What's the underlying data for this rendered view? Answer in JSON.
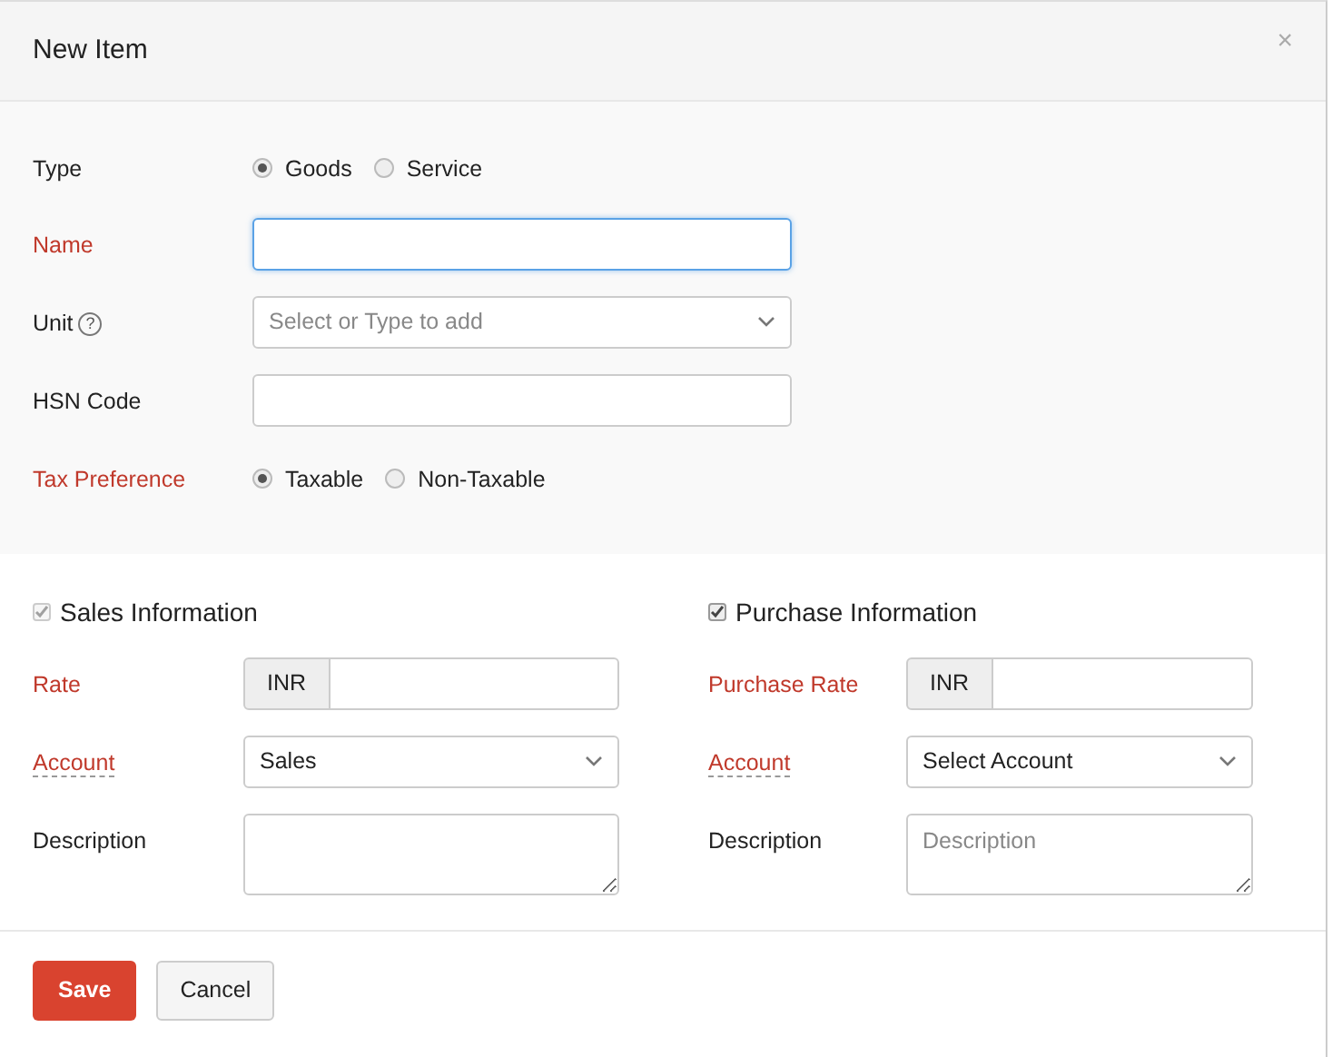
{
  "dialog": {
    "title": "New Item",
    "close": "×"
  },
  "fields": [
    {
      "label": "Type",
      "kind": "radio",
      "required": false,
      "options": [
        {
          "label": "Goods",
          "selected": true
        },
        {
          "label": "Service",
          "selected": false
        }
      ]
    },
    {
      "label": "Name",
      "kind": "text",
      "required": true,
      "focused": true
    },
    {
      "label": "Unit",
      "kind": "select",
      "required": false,
      "help": "?",
      "placeholder": "Select or Type to add"
    },
    {
      "label": "HSN Code",
      "kind": "text",
      "required": false,
      "focused": false
    },
    {
      "label": "Tax Preference",
      "kind": "radio",
      "required": true,
      "options": [
        {
          "label": "Taxable",
          "selected": true
        },
        {
          "label": "Non-Taxable",
          "selected": false
        }
      ]
    }
  ],
  "sections": [
    {
      "title": "Sales Information",
      "checked": true,
      "disabled": true,
      "fields": [
        {
          "label": "Rate",
          "kind": "currency",
          "required": true,
          "underlined": false,
          "addon": "INR"
        },
        {
          "label": "Account",
          "kind": "select",
          "required": true,
          "underlined": true,
          "value": "Sales"
        },
        {
          "label": "Description",
          "kind": "textarea",
          "required": false,
          "underlined": false
        }
      ]
    },
    {
      "title": "Purchase Information",
      "checked": true,
      "disabled": false,
      "fields": [
        {
          "label": "Purchase Rate",
          "kind": "currency",
          "required": true,
          "underlined": false,
          "addon": "INR"
        },
        {
          "label": "Account",
          "kind": "select",
          "required": true,
          "underlined": true,
          "value": "Select Account"
        },
        {
          "label": "Description",
          "kind": "textarea",
          "required": false,
          "underlined": false,
          "placeholder": "Description"
        }
      ]
    }
  ],
  "buttons": [
    {
      "label": "Save",
      "kind": "primary"
    },
    {
      "label": "Cancel",
      "kind": "secondary"
    }
  ]
}
